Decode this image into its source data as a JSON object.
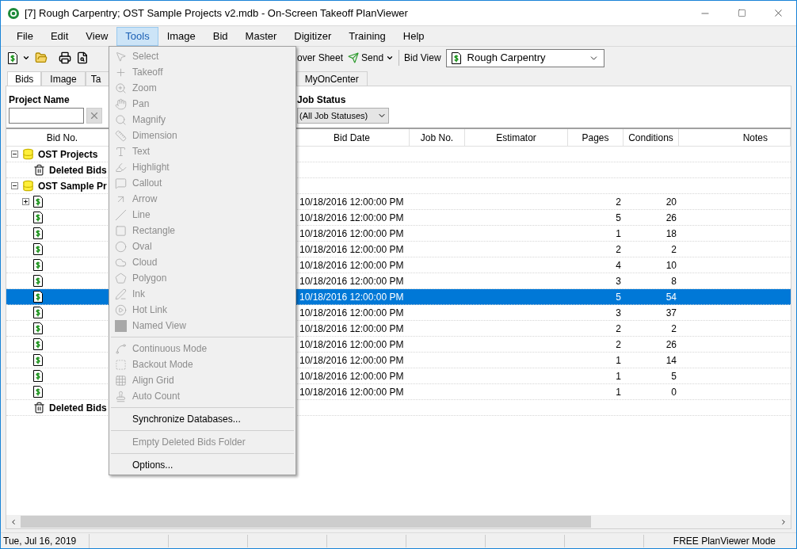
{
  "window": {
    "title": "[7] Rough Carpentry; OST Sample Projects v2.mdb - On-Screen Takeoff PlanViewer"
  },
  "menu_bar": [
    {
      "label": "File",
      "selected": false
    },
    {
      "label": "Edit",
      "selected": false
    },
    {
      "label": "View",
      "selected": false
    },
    {
      "label": "Tools",
      "selected": true
    },
    {
      "label": "Image",
      "selected": false
    },
    {
      "label": "Bid",
      "selected": false
    },
    {
      "label": "Master",
      "selected": false
    },
    {
      "label": "Digitizer",
      "selected": false
    },
    {
      "label": "Training",
      "selected": false
    },
    {
      "label": "Help",
      "selected": false
    }
  ],
  "toolbar": {
    "cover_sheet": "over Sheet",
    "send": "Send",
    "bid_view_label": "Bid View",
    "bid_view_value": "Rough Carpentry"
  },
  "tabs": [
    {
      "label": "Bids",
      "selected": true
    },
    {
      "label": "Image",
      "selected": false
    },
    {
      "label": "Ta",
      "selected": false
    },
    {
      "label": "MyOnCenter",
      "selected": false
    }
  ],
  "filters": {
    "project_name_label": "Project Name",
    "job_status_label": "Job Status",
    "job_status_value": "(All Job Statuses)"
  },
  "table": {
    "columns": [
      "Bid No.",
      "Bid Date",
      "Job No.",
      "Estimator",
      "Pages",
      "Conditions",
      "Notes"
    ],
    "tree": [
      {
        "kind": "group",
        "label": "OST Projects",
        "expanded": true,
        "children": [
          {
            "kind": "trash",
            "label": "Deleted Bids"
          }
        ]
      },
      {
        "kind": "group",
        "label": "OST Sample Pr",
        "expanded": true,
        "children": [
          {
            "kind": "bid",
            "expanded": false,
            "selected": false,
            "bid_date": "10/18/2016 12:00:00 PM",
            "pages": "2",
            "conditions": "20"
          },
          {
            "kind": "bid",
            "selected": false,
            "bid_date": "10/18/2016 12:00:00 PM",
            "pages": "5",
            "conditions": "26"
          },
          {
            "kind": "bid",
            "selected": false,
            "bid_date": "10/18/2016 12:00:00 PM",
            "pages": "1",
            "conditions": "18"
          },
          {
            "kind": "bid",
            "selected": false,
            "bid_date": "10/18/2016 12:00:00 PM",
            "pages": "2",
            "conditions": "2"
          },
          {
            "kind": "bid",
            "selected": false,
            "bid_date": "10/18/2016 12:00:00 PM",
            "pages": "4",
            "conditions": "10"
          },
          {
            "kind": "bid",
            "selected": false,
            "bid_date": "10/18/2016 12:00:00 PM",
            "pages": "3",
            "conditions": "8"
          },
          {
            "kind": "bid",
            "selected": true,
            "bid_date": "10/18/2016 12:00:00 PM",
            "pages": "5",
            "conditions": "54"
          },
          {
            "kind": "bid",
            "selected": false,
            "bid_date": "10/18/2016 12:00:00 PM",
            "pages": "3",
            "conditions": "37"
          },
          {
            "kind": "bid",
            "selected": false,
            "bid_date": "10/18/2016 12:00:00 PM",
            "pages": "2",
            "conditions": "2"
          },
          {
            "kind": "bid",
            "selected": false,
            "bid_date": "10/18/2016 12:00:00 PM",
            "pages": "2",
            "conditions": "26"
          },
          {
            "kind": "bid",
            "selected": false,
            "bid_date": "10/18/2016 12:00:00 PM",
            "pages": "1",
            "conditions": "14"
          },
          {
            "kind": "bid",
            "selected": false,
            "bid_date": "10/18/2016 12:00:00 PM",
            "pages": "1",
            "conditions": "5"
          },
          {
            "kind": "bid",
            "selected": false,
            "bid_date": "10/18/2016 12:00:00 PM",
            "pages": "1",
            "conditions": "0"
          },
          {
            "kind": "trash",
            "label": "Deleted Bids"
          }
        ]
      }
    ]
  },
  "tools_menu": {
    "groups": [
      [
        {
          "label": "Select",
          "disabled": true
        },
        {
          "label": "Takeoff",
          "disabled": true
        },
        {
          "label": "Zoom",
          "disabled": true
        },
        {
          "label": "Pan",
          "disabled": true
        },
        {
          "label": "Magnify",
          "disabled": true
        },
        {
          "label": "Dimension",
          "disabled": true
        },
        {
          "label": "Text",
          "disabled": true
        },
        {
          "label": "Highlight",
          "disabled": true
        },
        {
          "label": "Callout",
          "disabled": true
        },
        {
          "label": "Arrow",
          "disabled": true
        },
        {
          "label": "Line",
          "disabled": true
        },
        {
          "label": "Rectangle",
          "disabled": true
        },
        {
          "label": "Oval",
          "disabled": true
        },
        {
          "label": "Cloud",
          "disabled": true
        },
        {
          "label": "Polygon",
          "disabled": true
        },
        {
          "label": "Ink",
          "disabled": true
        },
        {
          "label": "Hot Link",
          "disabled": true
        },
        {
          "label": "Named View",
          "disabled": true
        }
      ],
      [
        {
          "label": "Continuous Mode",
          "disabled": true
        },
        {
          "label": "Backout Mode",
          "disabled": true
        },
        {
          "label": "Align Grid",
          "disabled": true
        },
        {
          "label": "Auto Count",
          "disabled": true
        }
      ],
      [
        {
          "label": "Synchronize Databases...",
          "disabled": false
        }
      ],
      [
        {
          "label": "Empty Deleted Bids Folder",
          "disabled": true
        }
      ],
      [
        {
          "label": "Options...",
          "disabled": false
        }
      ]
    ]
  },
  "status_bar": [
    "Tue, Jul 16, 2019",
    "FREE PlanViewer Mode"
  ]
}
